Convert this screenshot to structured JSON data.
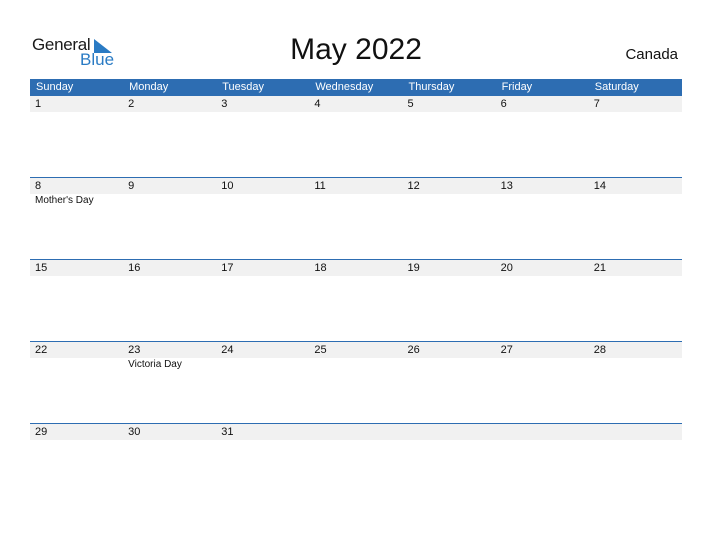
{
  "logo": {
    "line1": "General",
    "line2": "Blue"
  },
  "title": "May 2022",
  "country": "Canada",
  "colors": {
    "header_bg": "#2d6db2",
    "row_bg": "#f1f1f1"
  },
  "weekdays": [
    "Sunday",
    "Monday",
    "Tuesday",
    "Wednesday",
    "Thursday",
    "Friday",
    "Saturday"
  ],
  "weeks": [
    {
      "days": [
        "1",
        "2",
        "3",
        "4",
        "5",
        "6",
        "7"
      ],
      "events": [
        "",
        "",
        "",
        "",
        "",
        "",
        ""
      ]
    },
    {
      "days": [
        "8",
        "9",
        "10",
        "11",
        "12",
        "13",
        "14"
      ],
      "events": [
        "Mother's Day",
        "",
        "",
        "",
        "",
        "",
        ""
      ]
    },
    {
      "days": [
        "15",
        "16",
        "17",
        "18",
        "19",
        "20",
        "21"
      ],
      "events": [
        "",
        "",
        "",
        "",
        "",
        "",
        ""
      ]
    },
    {
      "days": [
        "22",
        "23",
        "24",
        "25",
        "26",
        "27",
        "28"
      ],
      "events": [
        "",
        "Victoria Day",
        "",
        "",
        "",
        "",
        ""
      ]
    },
    {
      "days": [
        "29",
        "30",
        "31",
        "",
        "",
        "",
        ""
      ],
      "events": [
        "",
        "",
        "",
        "",
        "",
        "",
        ""
      ]
    }
  ]
}
